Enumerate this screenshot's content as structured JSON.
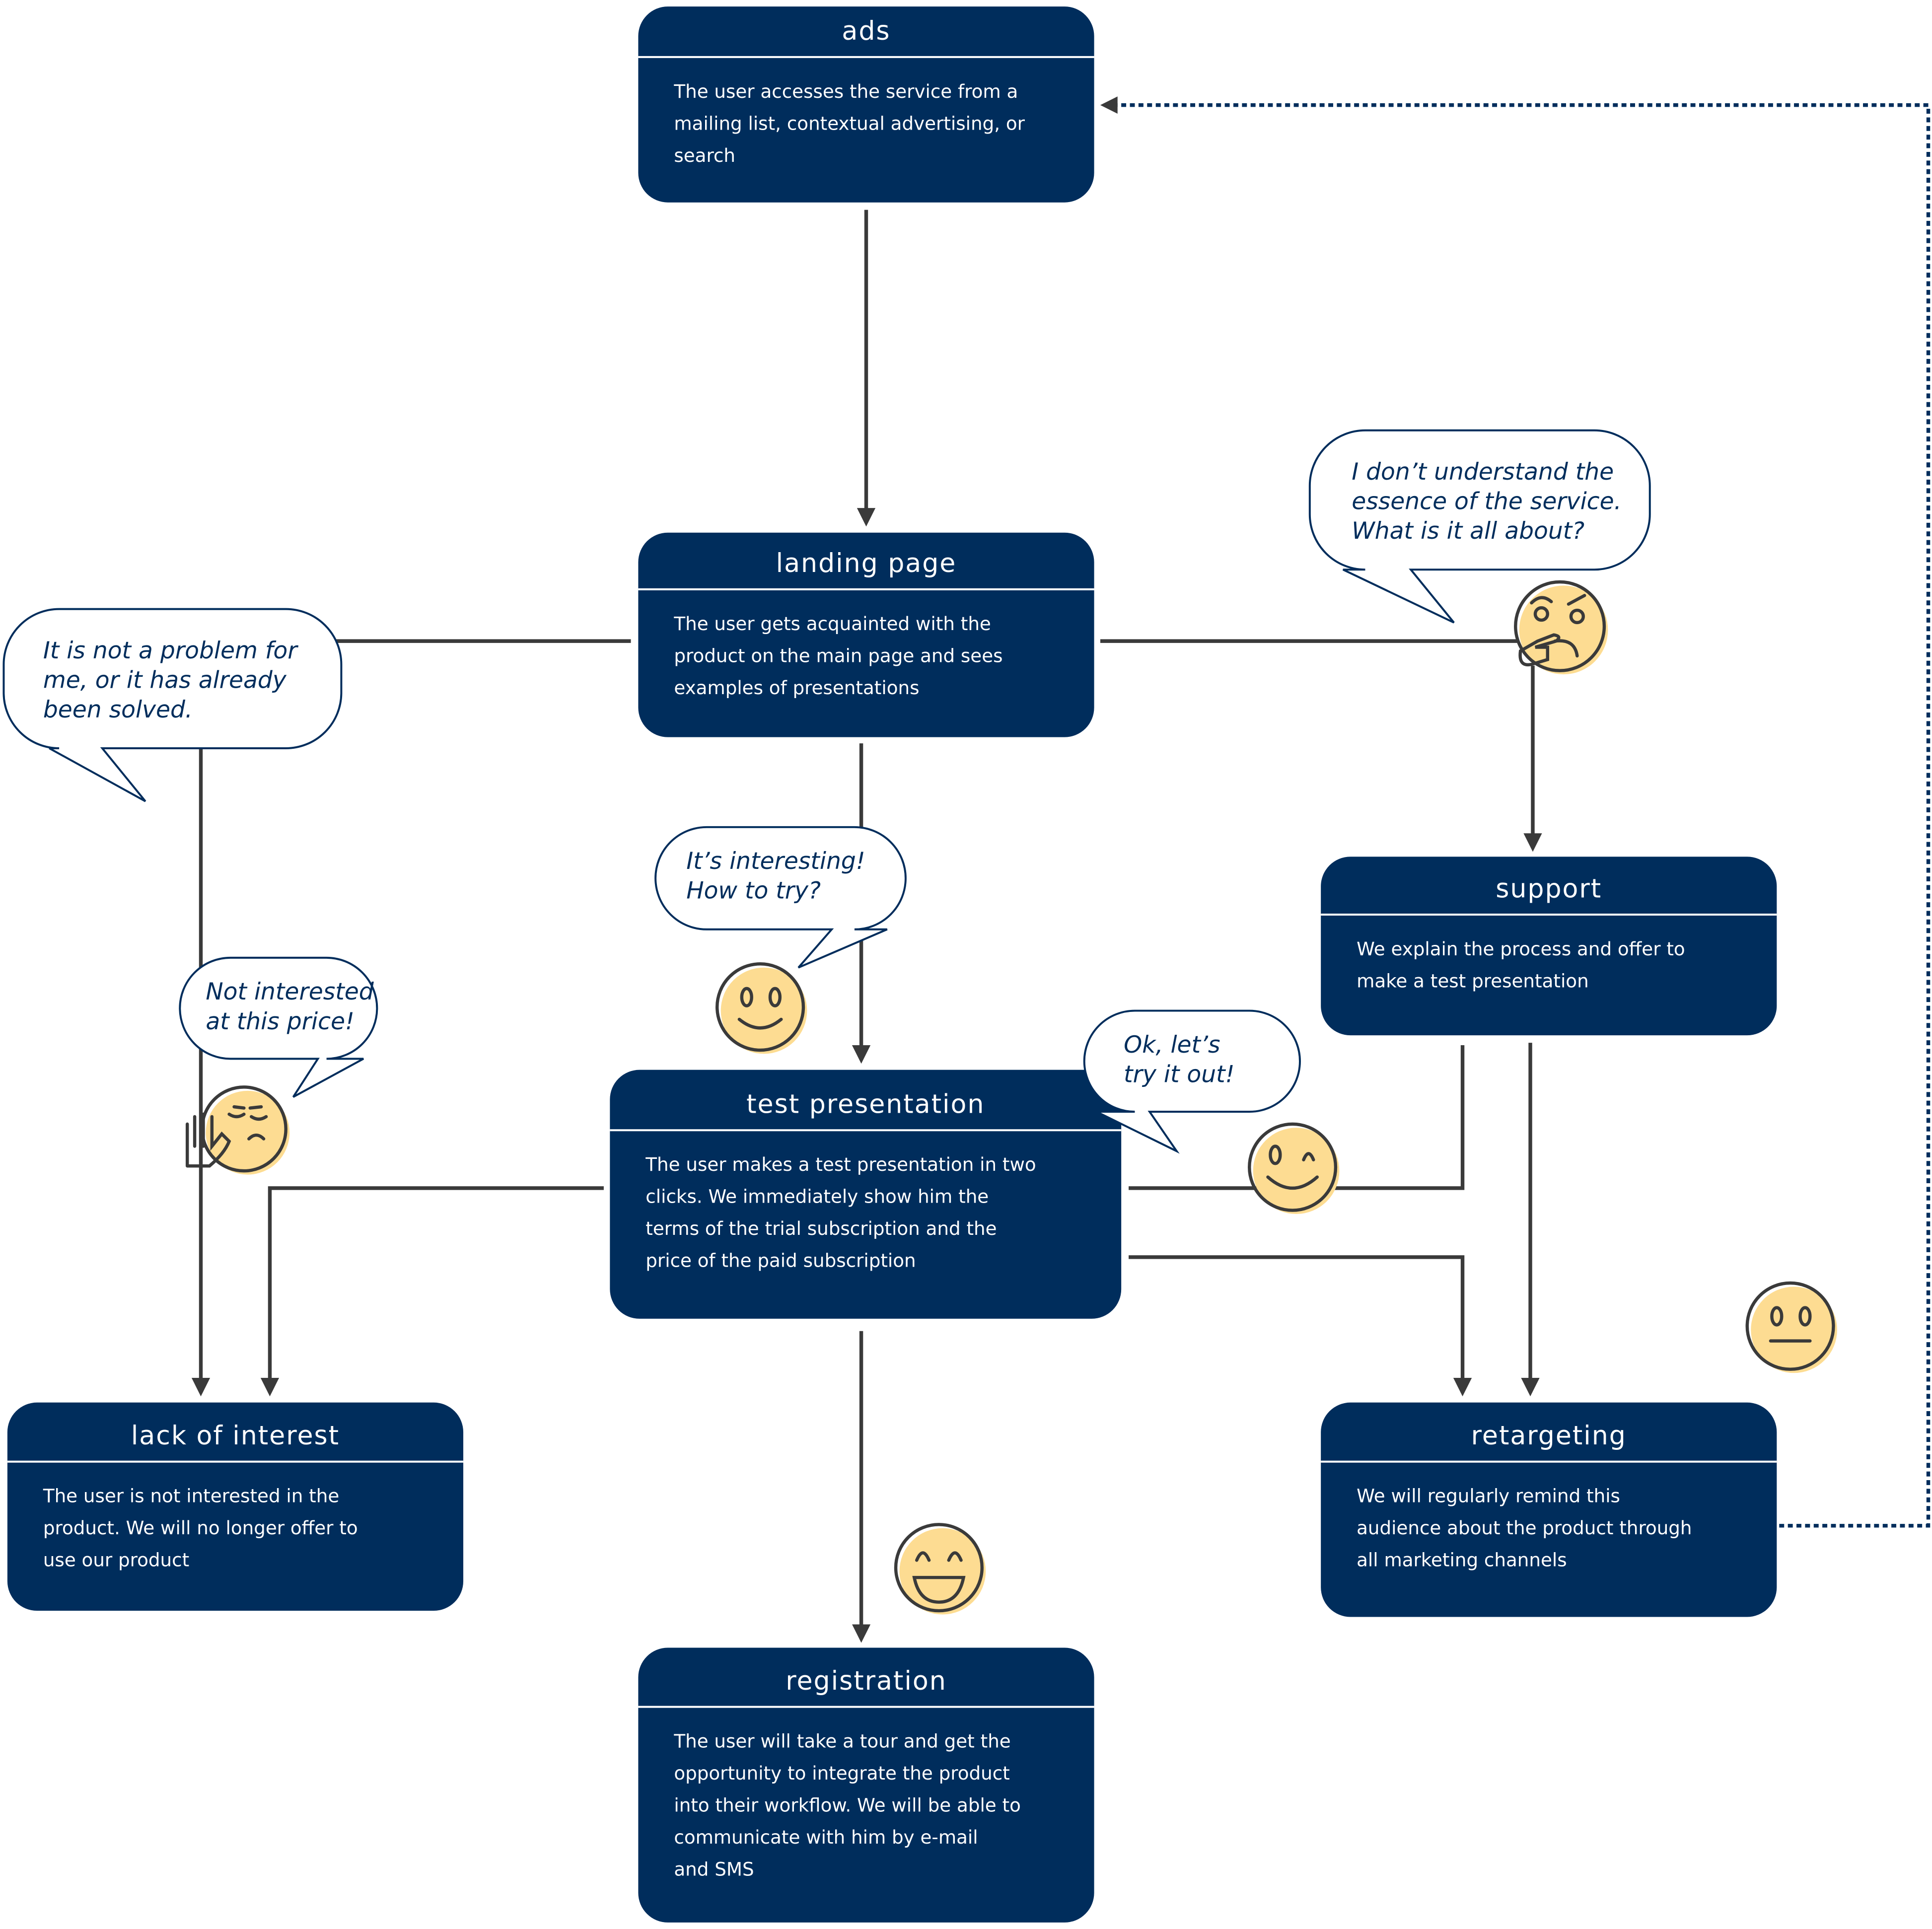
{
  "colors": {
    "box": "#002d5c",
    "face": "#fddc92",
    "connector": "#3a3a3a"
  },
  "nodes": {
    "ads": {
      "title": "ads",
      "lines": [
        "The user accesses the service from a",
        "mailing list, contextual advertising, or",
        "search"
      ]
    },
    "landing": {
      "title": "landing page",
      "lines": [
        "The user gets acquainted with the",
        "product on the main page and sees",
        "examples of presentations"
      ]
    },
    "test": {
      "title": "test presentation",
      "lines": [
        "The user makes a test presentation in two",
        "clicks. We immediately show him the",
        "terms of the trial subscription and the",
        "price of the paid subscription"
      ]
    },
    "support": {
      "title": "support",
      "lines": [
        "We explain the process and offer to",
        "make a test presentation"
      ]
    },
    "lack": {
      "title": "lack of interest",
      "lines": [
        "The user is not interested in the",
        "product. We will no longer offer to",
        "use our product"
      ]
    },
    "retargeting": {
      "title": "retargeting",
      "lines": [
        "We will regularly remind this",
        "audience about the product through",
        "all marketing channels"
      ]
    },
    "registration": {
      "title": "registration",
      "lines": [
        "The user will take a tour and get the",
        "opportunity to integrate the product",
        "into their workflow. We will be able to",
        "communicate with him by e-mail",
        "and SMS"
      ]
    }
  },
  "bubbles": {
    "solved": [
      "It is not a problem for",
      "me, or it has already",
      "been solved."
    ],
    "understand": [
      "I don’t understand the",
      "essence of the service.",
      "What is it all about?"
    ],
    "interesting": [
      "It’s interesting!",
      "How to try?"
    ],
    "price": [
      "Not interested",
      "at this price!"
    ],
    "ok": [
      "Ok, let’s",
      "try it out!"
    ]
  },
  "emojis": [
    "thinking-face",
    "smiling-face",
    "tired-face-with-stop-hand",
    "winking-smile-face",
    "neutral-face",
    "grinning-face"
  ]
}
